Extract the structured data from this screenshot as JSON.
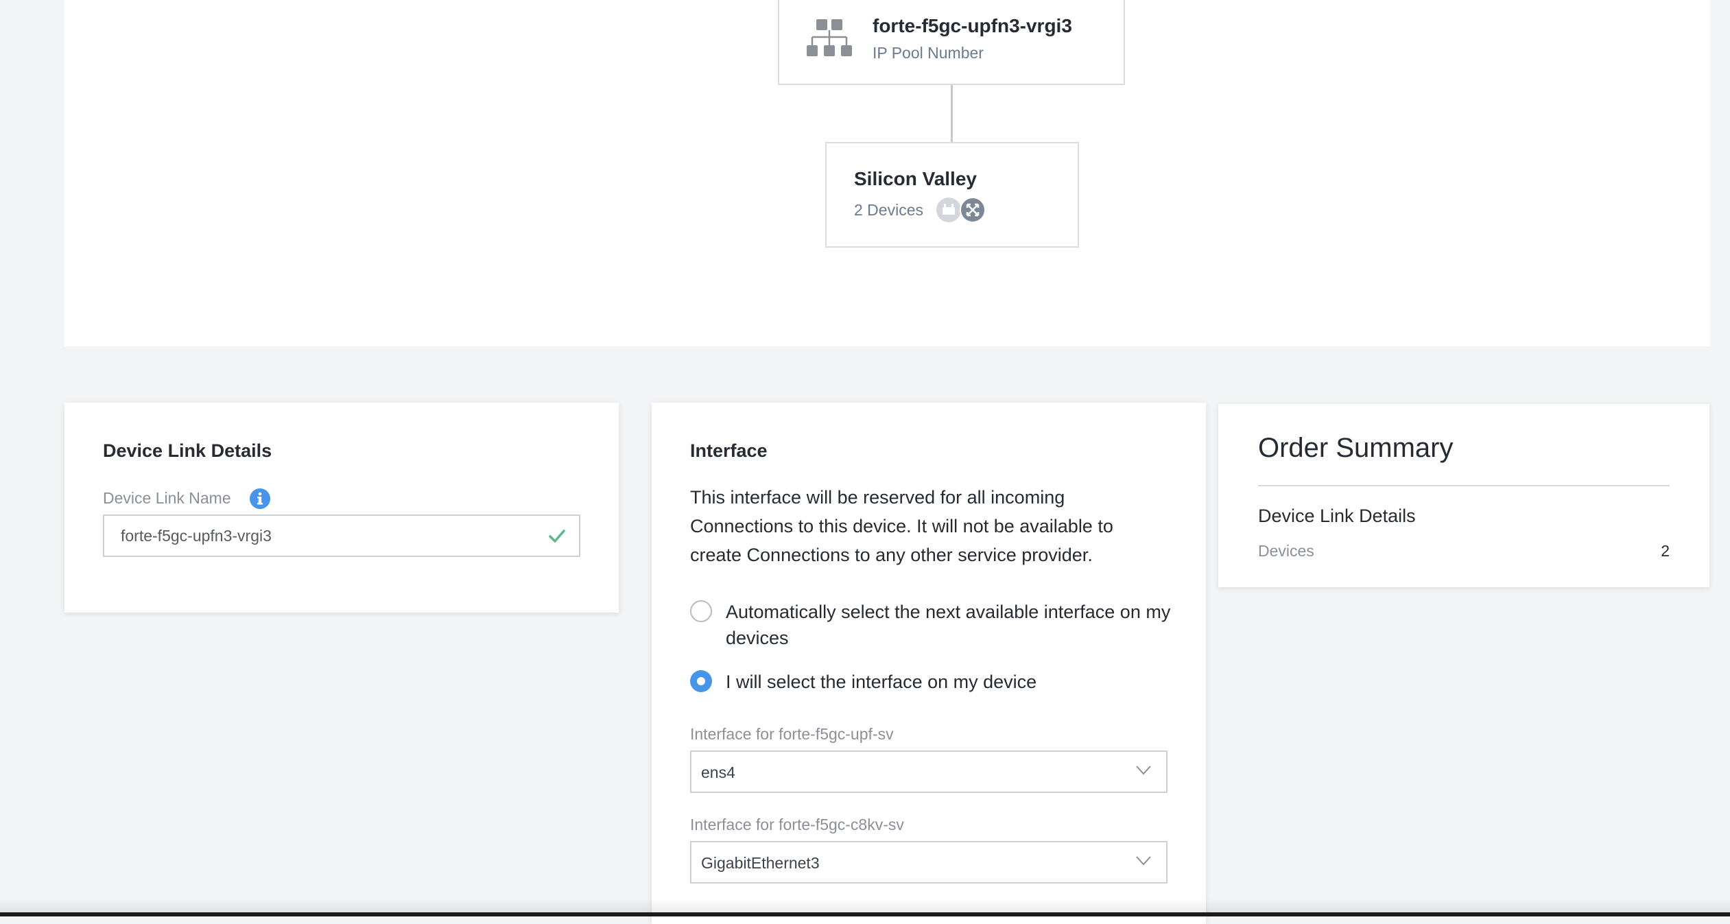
{
  "topology": {
    "pool_node": {
      "title": "forte-f5gc-upfn3-vrgi3",
      "subtitle": "IP Pool Number",
      "icon": "network-hierarchy-icon"
    },
    "site_node": {
      "title": "Silicon Valley",
      "subtitle": "2 Devices",
      "icons": [
        "router-device-icon",
        "switch-device-icon"
      ]
    }
  },
  "device_link_details": {
    "heading": "Device Link Details",
    "name_label": "Device Link Name",
    "name_value": "forte-f5gc-upfn3-vrgi3",
    "info_icon": "info-icon",
    "valid_icon": "checkmark-icon"
  },
  "interface": {
    "heading": "Interface",
    "description": "This interface will be reserved for all incoming Connections to this device. It will not be available to create Connections to any other service provider.",
    "options": [
      {
        "label": "Automatically select the next available interface on my devices",
        "selected": false
      },
      {
        "label": "I will select the interface on my device",
        "selected": true
      }
    ],
    "selects": [
      {
        "label": "Interface for forte-f5gc-upf-sv",
        "value": "ens4"
      },
      {
        "label": "Interface for forte-f5gc-c8kv-sv",
        "value": "GigabitEthernet3"
      }
    ]
  },
  "order_summary": {
    "title": "Order Summary",
    "section": "Device Link Details",
    "rows": [
      {
        "key": "Devices",
        "value": "2"
      }
    ]
  },
  "colors": {
    "accent": "#4795ea",
    "success": "#5cb88a",
    "icon_gray": "#8c9096"
  }
}
